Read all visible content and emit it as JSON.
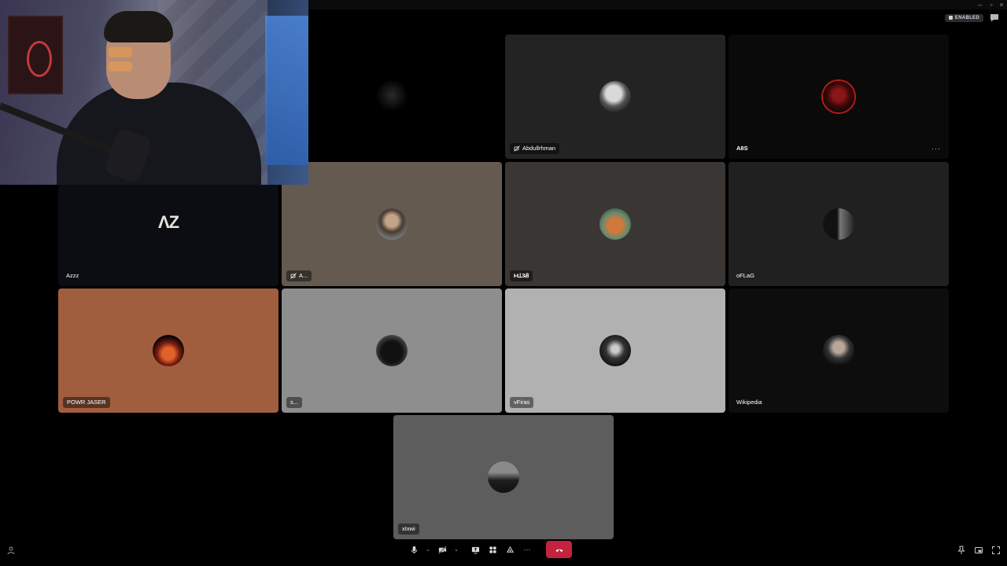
{
  "topbar": {
    "status_badge": "ENABLED"
  },
  "tiles": [
    {
      "name": "",
      "bg": "#000000"
    },
    {
      "name": "Abdullrhman",
      "bg": "#232323",
      "muted": true
    },
    {
      "name": "A8S",
      "bg": "#0a0a0a"
    },
    {
      "name": "Azzz",
      "bg": "#0c0d12",
      "logo": "ΛZ"
    },
    {
      "name": "A...",
      "bg": "#645a4f",
      "muted": true
    },
    {
      "name": "ⲘꞱ3Ᏸ",
      "bg": "#393634"
    },
    {
      "name": "oFLaG",
      "bg": "#202020"
    },
    {
      "name": "POWR JASER",
      "bg": "#a05e3f"
    },
    {
      "name": "s...",
      "bg": "#8e8e8e"
    },
    {
      "name": "vFiras",
      "bg": "#b1b1b1"
    },
    {
      "name": "Wikipedia",
      "bg": "#0d0d0d"
    },
    {
      "name": "xIxwi",
      "bg": "#5d5d5d"
    }
  ],
  "icons": {
    "mic": "microphone-icon",
    "camera": "camera-off-icon",
    "screen": "screen-share-icon",
    "activities": "activities-icon",
    "soundboard": "soundboard-icon",
    "more": "more-options-icon",
    "end": "end-call-icon",
    "chat": "chat-icon",
    "pin": "pin-icon",
    "popout": "popout-icon",
    "fullscreen": "fullscreen-icon",
    "settings": "voice-settings-icon"
  }
}
